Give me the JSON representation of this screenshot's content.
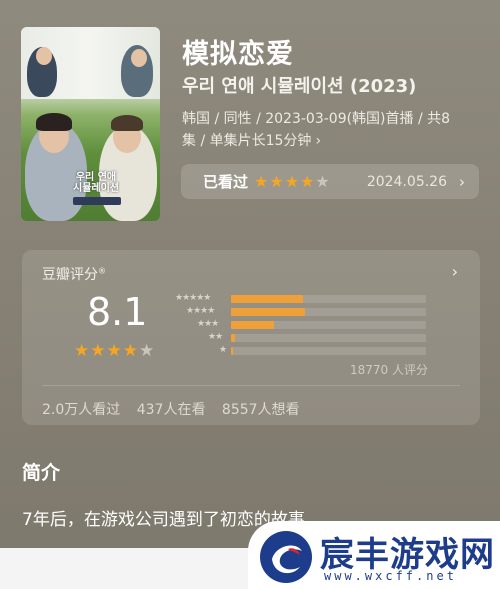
{
  "movie": {
    "title": "模拟恋爱",
    "original_title": "우리 연애 시뮬레이션 (2023)",
    "meta_line1": "韩国 / 同性 / 2023-03-09(韩国)首播 / 共8",
    "meta_line2": "集 / 单集片长15分钟",
    "meta_chevron": "›",
    "poster_logo": "우리 연애 시뮬레이션"
  },
  "watched": {
    "label": "已看过",
    "stars_on": 4,
    "stars_total": 5,
    "date": "2024.05.26",
    "chevron": "›"
  },
  "rating": {
    "title": "豆瓣评分",
    "title_mark": "®",
    "chevron": "›",
    "score": "8.1",
    "stars_on": 4,
    "stars_total": 5,
    "distribution": [
      {
        "stars": 5,
        "label": "★★★★★",
        "percent": 37
      },
      {
        "stars": 4,
        "label": "★★★★",
        "percent": 38
      },
      {
        "stars": 3,
        "label": "★★★",
        "percent": 22
      },
      {
        "stars": 2,
        "label": "★★",
        "percent": 2
      },
      {
        "stars": 1,
        "label": "★",
        "percent": 1
      }
    ],
    "count_text": "18770 人评分",
    "stats": [
      "2.0万人看过",
      "437人在看",
      "8557人想看"
    ]
  },
  "intro": {
    "title": "简介",
    "text": "7年后，在游戏公司遇到了初恋的故事。"
  },
  "watermark": {
    "name": "宸丰游戏网",
    "url": "www.wxcff.net"
  },
  "colors": {
    "star_on": "#f5a623",
    "bar_fill": "#f0a038",
    "background": "#8a8579",
    "watermark_blue": "#1d3d8c"
  }
}
